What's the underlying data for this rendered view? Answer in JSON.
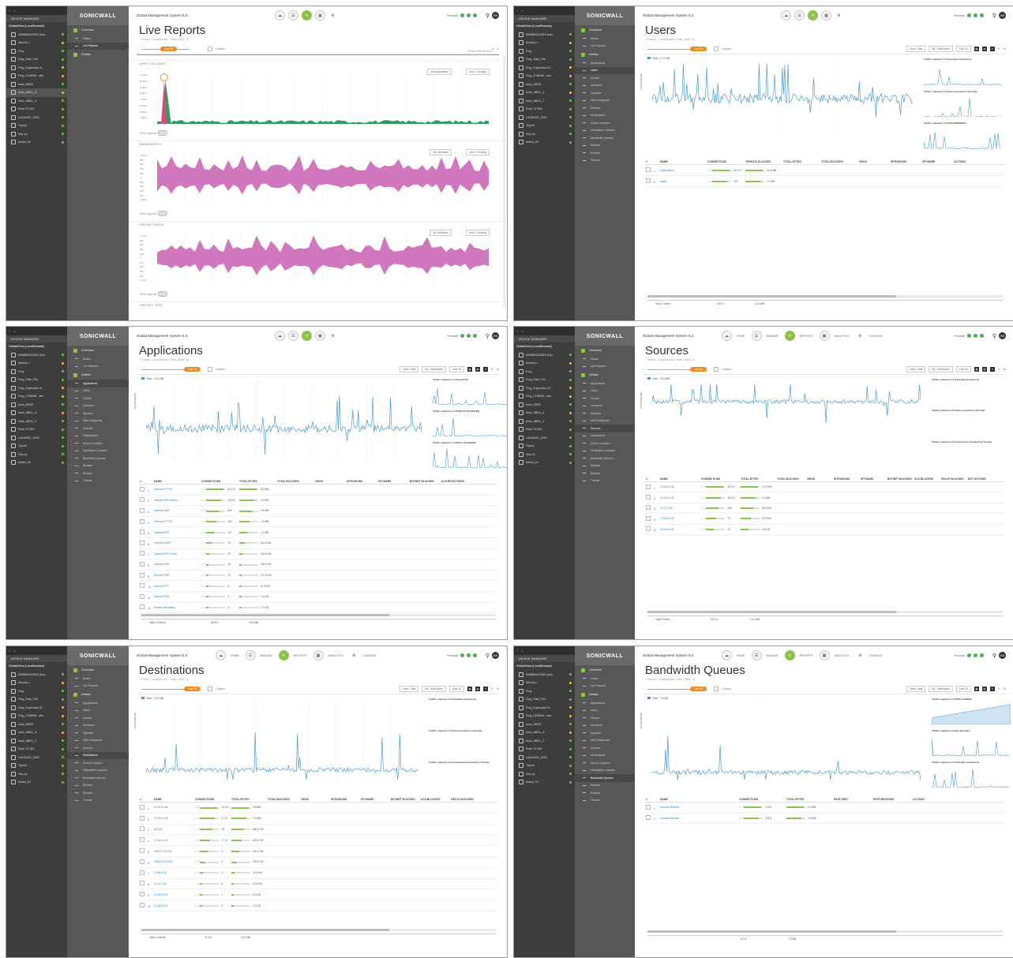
{
  "brand": "SONICWALL",
  "app_title": "Global Management System 9.2",
  "device_manager_header": "DEVICE MANAGER",
  "tree": {
    "root": "GlobalView (LocalDomain)",
    "items": [
      "0006B5A2C8E8 (hos..",
      "Alumny-1",
      "Fmg",
      "Fmg_Stab_Fhh",
      "Fmg_Supervisor-N...",
      "Fmg_CONNW - abc",
      "Isotc_WIDE",
      "Isotc_ABDL_A",
      "Isotc_ABDL_2",
      "Ross TZ 500",
      "LAZANCE_2000",
      "Trynoll",
      "Vby-Vy",
      "tested_03"
    ],
    "status": [
      "g",
      "y",
      "g",
      "g",
      "y",
      "y",
      "g",
      "y",
      "g",
      "g",
      "g",
      "g",
      "g",
      "g"
    ]
  },
  "nav": {
    "overview": "Overview",
    "overview_items": [
      "Status",
      "Live Reports"
    ],
    "details": "Details",
    "details_items": [
      "Applications",
      "Users",
      "Viruses",
      "Intrusions",
      "Spyware",
      "Web Categories",
      "Sources",
      "Destinations",
      "Source Location",
      "Destination Location",
      "Bandwidth Queues",
      "Blocked",
      "Blocked",
      "Threats"
    ]
  },
  "topnav": [
    "HOME",
    "MANAGE",
    "REPORTS",
    "ANALYTICS",
    "CONSOLE"
  ],
  "toolbar": {
    "firewall_label": "Firewall",
    "zoom": "Last 30",
    "view_label": "View: Total",
    "by_label": "By: Total Bytes",
    "custom": "Custom",
    "live": "Live"
  },
  "panels": {
    "live": {
      "title": "Live Reports",
      "crumb": "/ Tenant - LocalDomain / Isotc_ABDL_A",
      "timestamp": "22 Nov 2018 09:04:17",
      "sections": [
        "APPLICATIONS",
        "BANDWIDTH",
        "PACKET RATE",
        "PACKET SIZE"
      ],
      "filter_applications": "All Applications",
      "filter_interfaces": "All Interfaces",
      "scaling": "Auto Y-Scaling",
      "show_legends": "Show Legends",
      "y_ticks_apps": [
        "11 Mbps",
        "10 Mbps",
        "9 Mbps",
        "8 Mbps",
        "7 Mbps",
        "6 Mbps",
        "5 Mbps",
        "4 Mbps"
      ],
      "y_ticks_bw": [
        "1 Mbps",
        "800",
        "600",
        "400",
        "200",
        "0",
        "200",
        "400",
        "600",
        "800",
        "1 Mbps"
      ],
      "y_ticks_pkt": [
        "1 Kbps",
        "800",
        "600",
        "400",
        "200",
        "0",
        "200",
        "400",
        "600",
        "800",
        "1 Kbps"
      ]
    },
    "users": {
      "title": "Users",
      "crumb": "/ Tenant - LocalDomain / Isotc_ABDL_A",
      "legend": "Total - 12.5 MB",
      "select_hint": "Select chart to zoom",
      "y_label": "Total Bandwidth",
      "y_ticks": [
        "300KB",
        "200KB",
        "100KB"
      ],
      "snap_titles": [
        "Traffic snapshot of Total data transferred",
        "Traffic snapshot of Total connections blocked",
        "Traffic snapshot of DATA BROWSED"
      ],
      "columns": [
        "#",
        "NAME",
        "CONNECTIONS",
        "THREATS BLOCKED",
        "TOTAL BYTES",
        "TOTAL BLOCKED",
        "VIRUS",
        "INTRUSIONS",
        "SPYWARE",
        "ACTIONS"
      ],
      "rows": [
        {
          "n": "1",
          "name": "unidentified",
          "conn": "83.3 K",
          "bytes": "12.5 MB"
        },
        {
          "n": "2",
          "name": "admin",
          "conn": "347",
          "bytes": "1.2 MB"
        }
      ],
      "total_label": "Total 2 Users",
      "total_conn": "83.6 K",
      "total_bytes": "12.6 MB"
    },
    "apps": {
      "title": "Applications",
      "crumb": "/ Tenant - LocalDomain / Isotc_ABDL_A",
      "legend": "Total - 20.5 MB",
      "select_hint": "Select chart to zoom",
      "y_label": "Total Bandwidth",
      "y_ticks": [
        "20KB",
        "150KB",
        "100KB"
      ],
      "snap_titles": [
        "Traffic snapshot of Total BYTE",
        "Traffic snapshot of THREATS BLOCKED",
        "Traffic snapshot of TOTAL BLOCKED"
      ],
      "columns": [
        "#",
        "NAME",
        "CONNECTIONS",
        "TOTAL BYTES",
        "TOTAL BLOCKED",
        "VIRUS",
        "INTRUSIONS",
        "SPYWARE",
        "BOTNET BLOCKED",
        "ACS REJECTIONS"
      ],
      "rows": [
        {
          "n": "1",
          "name": "General HTTPS",
          "conn": "44.3 K",
          "bytes": "8.9 MB"
        },
        {
          "n": "2",
          "name": "General DNS Server",
          "conn": "23.8 K",
          "bytes": "4.9 MB"
        },
        {
          "n": "3",
          "name": "General UDP",
          "conn": "809",
          "bytes": "2.6 MB"
        },
        {
          "n": "4",
          "name": "General HTTPS",
          "conn": "240",
          "bytes": "1.8 MB"
        },
        {
          "n": "5",
          "name": "General NTP",
          "conn": "127",
          "bytes": "1.2 MB"
        },
        {
          "n": "6",
          "name": "General ICMP",
          "conn": "73",
          "bytes": "511.0 KB"
        },
        {
          "n": "7",
          "name": "General NTP Client",
          "conn": "29",
          "bytes": "432.9 KB"
        },
        {
          "n": "8",
          "name": "General DNS",
          "conn": "16",
          "bytes": "290.1 KB"
        },
        {
          "n": "9",
          "name": "Service SMB",
          "conn": "12",
          "bytes": "127.4 KB"
        },
        {
          "n": "10",
          "name": "General FTP",
          "conn": "8",
          "bytes": "21.8 KB"
        },
        {
          "n": "11",
          "name": "General SSH",
          "conn": "5",
          "bytes": "7.8 KB"
        },
        {
          "n": "12",
          "name": "Service Streaming",
          "conn": "3",
          "bytes": "2.3 KB"
        }
      ],
      "total_label": "Total 12 Items",
      "total_conn": "86.8 K",
      "total_bytes": "20.8 MB"
    },
    "sources": {
      "title": "Sources",
      "crumb": "/ Tenant - LocalDomain / Isotc_ABDL_A",
      "legend": "Total - 15.6 MB",
      "select_hint": "Select chart to zoom",
      "y_label": "Total Bandwidth",
      "snap_titles": [
        "Traffic snapshot of Total data transferred",
        "Traffic snapshot of Total connections blocked",
        "Traffic snapshot of Connections blocked by Threats"
      ],
      "columns": [
        "#",
        "NAME",
        "CONNECTIONS",
        "TOTAL BYTES",
        "TOTAL BLOCKED",
        "VIRUS",
        "INTRUSIONS",
        "SPYWARE",
        "BOTNET BLOCKED",
        "ACS BLOCKED",
        "GEO-IP BLOCKED",
        "BOT ACTIONS"
      ],
      "rows": [
        {
          "n": "1",
          "name": "10.203.0.38",
          "conn": "48.9 K",
          "bytes": "12.9 MB"
        },
        {
          "n": "2",
          "name": "10.203.0.52",
          "conn": "33.8 K",
          "bytes": "2.3 MB"
        },
        {
          "n": "3",
          "name": "10.2.0.100",
          "conn": "396",
          "bytes": "86.8 KB"
        },
        {
          "n": "4",
          "name": "10.203.0.45",
          "conn": "74",
          "bytes": "22.5 KB"
        },
        {
          "n": "5",
          "name": "10.203.0.61",
          "conn": "12",
          "bytes": "5.8 KB"
        }
      ],
      "total_label": "Total 5 Items",
      "total_conn": "83.2 K",
      "total_bytes": "15.3 MB"
    },
    "dest": {
      "title": "Destinations",
      "crumb": "/ Tenant - LocalDomain / Isotc_ABDL_A",
      "range": "2016-12-15 09:28 to 2016-12-15 10:38",
      "legend": "Total - 15.6 MB",
      "select_hint": "Select chart to zoom",
      "y_label": "Total Bandwidth",
      "snap_titles": [
        "Traffic snapshot of Total data transferred",
        "Traffic snapshot of Total connections blocked",
        "Traffic snapshot of Connections blocked by Threats"
      ],
      "columns": [
        "#",
        "NAME",
        "CONNECTIONS",
        "TOTAL BYTES",
        "TOTAL BLOCKED",
        "VIRUS",
        "INTRUSIONS",
        "SPYWARE",
        "BOTNET BLOCKED",
        "ACS BLOCKED",
        "GEO-IP BLOCKED"
      ],
      "rows": [
        {
          "n": "1",
          "name": "10.203.0.38",
          "conn": "14.0 K",
          "bytes": "5.8 MB"
        },
        {
          "n": "2",
          "name": "10.203.0.38",
          "conn": "2.1 K",
          "bytes": "2.5 MB"
        },
        {
          "n": "3",
          "name": "8.8.8.8",
          "conn": "78",
          "bytes": "880.4 KB"
        },
        {
          "n": "4",
          "name": "10.203.0.45",
          "conn": "1.7 K",
          "bytes": "622.1 KB"
        },
        {
          "n": "5",
          "name": "208.67.222.222",
          "conn": "3",
          "bytes": "301.4 KB"
        },
        {
          "n": "6",
          "name": "208.67.220.220",
          "conn": "3",
          "bytes": "220.5 KB"
        },
        {
          "n": "7",
          "name": "23.45.67.8",
          "conn": "1",
          "bytes": "19.5 KB"
        },
        {
          "n": "8",
          "name": "10.2.0.100",
          "conn": "6",
          "bytes": "12.4 KB"
        },
        {
          "n": "9",
          "name": "10.203.0.52",
          "conn": "1",
          "bytes": "8.9 KB"
        },
        {
          "n": "10",
          "name": "10.203.0.61",
          "conn": "3",
          "bytes": "3.2 KB"
        }
      ],
      "total_label": "Total 10 Items",
      "total_conn": "21.8 K",
      "total_bytes": "10.4 MB"
    },
    "bwq": {
      "title": "Bandwidth Queues",
      "crumb": "/ Tenant - LocalDomain / Isotc_ABDL_A",
      "legend": "Total - 7.5 MB",
      "select_hint": "Select chart to zoom",
      "y_label": "Total Bandwidth",
      "snap_titles": [
        "Traffic snapshot of TOTAL RANGE",
        "Traffic snapshot of data blocked",
        "Traffic snapshot of Total data transferred"
      ],
      "columns": [
        "#",
        "NAME",
        "CONNECTIONS",
        "TOTAL BYTES",
        "RATE SENT",
        "RATE RECEIVED",
        "ACTIONS"
      ],
      "rows": [
        {
          "n": "1",
          "name": "General Medium",
          "conn": "4.6 K",
          "bytes": "3.9 MB"
        },
        {
          "n": "2",
          "name": "General Medium",
          "conn": "4.6 K",
          "bytes": "3.6 MB"
        }
      ],
      "total_conn": "9.2 K",
      "total_bytes": "7.5 MB"
    }
  },
  "colors": {
    "accent": "#f08a1c",
    "active_nav": "#8bc34a",
    "line": "#4a9ad4",
    "live_green": "#2e9e5b",
    "live_magenta": "#c95fb2",
    "sidebar": "#3d3d3d",
    "nav": "#575757"
  }
}
